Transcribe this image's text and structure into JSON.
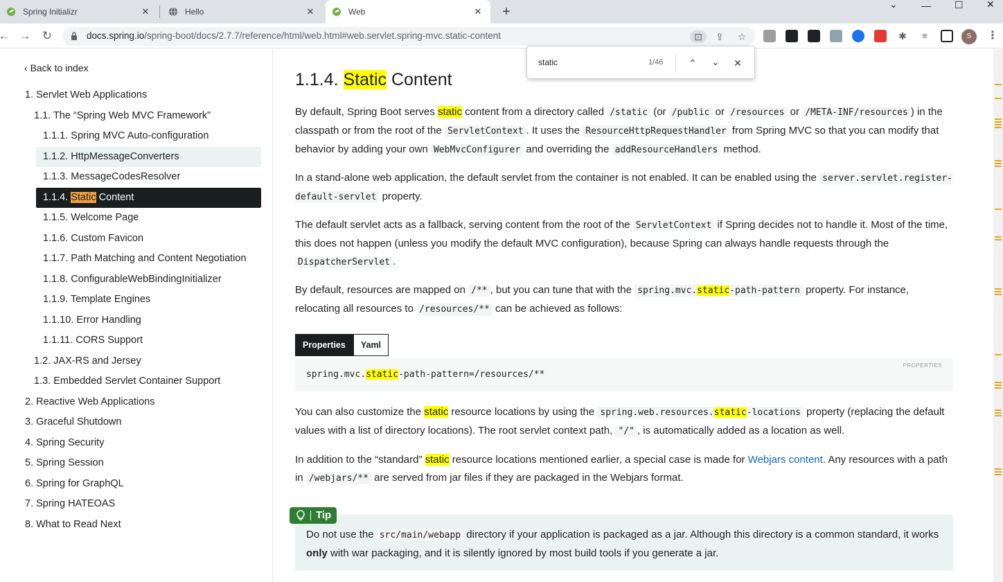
{
  "tabs": [
    {
      "title": "Spring Initializr",
      "icon": "spring-icon"
    },
    {
      "title": "Hello",
      "icon": "globe-icon"
    },
    {
      "title": "Web",
      "icon": "spring-icon",
      "active": true
    }
  ],
  "address_bar": {
    "host": "docs.spring.io",
    "path": "/spring-boot/docs/2.7.7/reference/html/web.html#web.servlet.spring-mvc.static-content"
  },
  "profile_initial": "S",
  "find_bar": {
    "query": "static",
    "count": "1/46"
  },
  "sidebar": {
    "back_label": "Back to index",
    "items": [
      {
        "label": "1. Servlet Web Applications"
      },
      {
        "label": "1.1. The “Spring Web MVC Framework”"
      },
      {
        "label": "1.1.1. Spring MVC Auto-configuration"
      },
      {
        "label": "1.1.2. HttpMessageConverters"
      },
      {
        "label": "1.1.3. MessageCodesResolver"
      },
      {
        "prefix": "1.1.4. ",
        "match": "Static",
        "suffix": " Content"
      },
      {
        "label": "1.1.5. Welcome Page"
      },
      {
        "label": "1.1.6. Custom Favicon"
      },
      {
        "label": "1.1.7. Path Matching and Content Negotiation"
      },
      {
        "label": "1.1.8. ConfigurableWebBindingInitializer"
      },
      {
        "label": "1.1.9. Template Engines"
      },
      {
        "label": "1.1.10. Error Handling"
      },
      {
        "label": "1.1.11. CORS Support"
      },
      {
        "label": "1.2. JAX-RS and Jersey"
      },
      {
        "label": "1.3. Embedded Servlet Container Support"
      },
      {
        "label": "2. Reactive Web Applications"
      },
      {
        "label": "3. Graceful Shutdown"
      },
      {
        "label": "4. Spring Security"
      },
      {
        "label": "5. Spring Session"
      },
      {
        "label": "6. Spring for GraphQL"
      },
      {
        "label": "7. Spring HATEOAS"
      },
      {
        "label": "8. What to Read Next"
      }
    ]
  },
  "content": {
    "heading_num": "1.1.4.",
    "heading_match": "Static",
    "heading_rest": "Content",
    "p1": {
      "a": "By default, Spring Boot serves ",
      "b": "static",
      "c": " content from a directory called ",
      "c1": "/static",
      "d": " (or ",
      "c2": "/public",
      "e": " or ",
      "c3": "/resources",
      "f": " or ",
      "c4": "/META-INF/resources",
      "g": ") in the classpath or from the root of the ",
      "c5": "ServletContext",
      "h": ". It uses the ",
      "c6": "ResourceHttpRequestHandler",
      "i": " from Spring MVC so that you can modify that behavior by adding your own ",
      "c7": "WebMvcConfigurer",
      "j": " and overriding the ",
      "c8": "addResourceHandlers",
      "k": " method."
    },
    "p2": {
      "a": "In a stand-alone web application, the default servlet from the container is not enabled. It can be enabled using the ",
      "c1": "server.servlet.register-default-servlet",
      "b": " property."
    },
    "p3": {
      "a": "The default servlet acts as a fallback, serving content from the root of the ",
      "c1": "ServletContext",
      "b": " if Spring decides not to handle it. Most of the time, this does not happen (unless you modify the default MVC configuration), because Spring can always handle requests through the ",
      "c2": "DispatcherServlet",
      "c": "."
    },
    "p4": {
      "a": "By default, resources are mapped on ",
      "c1": "/**",
      "b": ", but you can tune that with the ",
      "c2a": "spring.mvc.",
      "c2m": "static",
      "c2b": "-path-pattern",
      "c": " property. For instance, relocating all resources to ",
      "c3": "/resources/**",
      "d": " can be achieved as follows:"
    },
    "code_tabs": {
      "properties": "Properties",
      "yaml": "Yaml"
    },
    "code_lang": "PROPERTIES",
    "code": {
      "a": "spring.mvc.",
      "m": "static",
      "b": "-path-pattern=/resources/**"
    },
    "p5": {
      "a": "You can also customize the ",
      "m": "static",
      "b": " resource locations by using the ",
      "c1a": "spring.web.resources.",
      "c1m": "static",
      "c1b": "-locations",
      "c": " property (replacing the default values with a list of directory locations). The root servlet context path, ",
      "c2": "\"/\"",
      "d": ", is automatically added as a location as well."
    },
    "p6": {
      "a": "In addition to the “standard” ",
      "m": "static",
      "b": " resource locations mentioned earlier, a special case is made for ",
      "link": "Webjars content",
      "c": ". Any resources with a path in ",
      "c1": "/webjars/**",
      "d": " are served from jar files if they are packaged in the Webjars format."
    },
    "tip": {
      "label": "Tip",
      "a": "Do not use the ",
      "c1": "src/main/webapp",
      "b": " directory if your application is packaged as a jar. Although this directory is a common standard, it works ",
      "bold": "only",
      "c": " with war packaging, and it is silently ignored by most build tools if you generate a jar."
    }
  }
}
